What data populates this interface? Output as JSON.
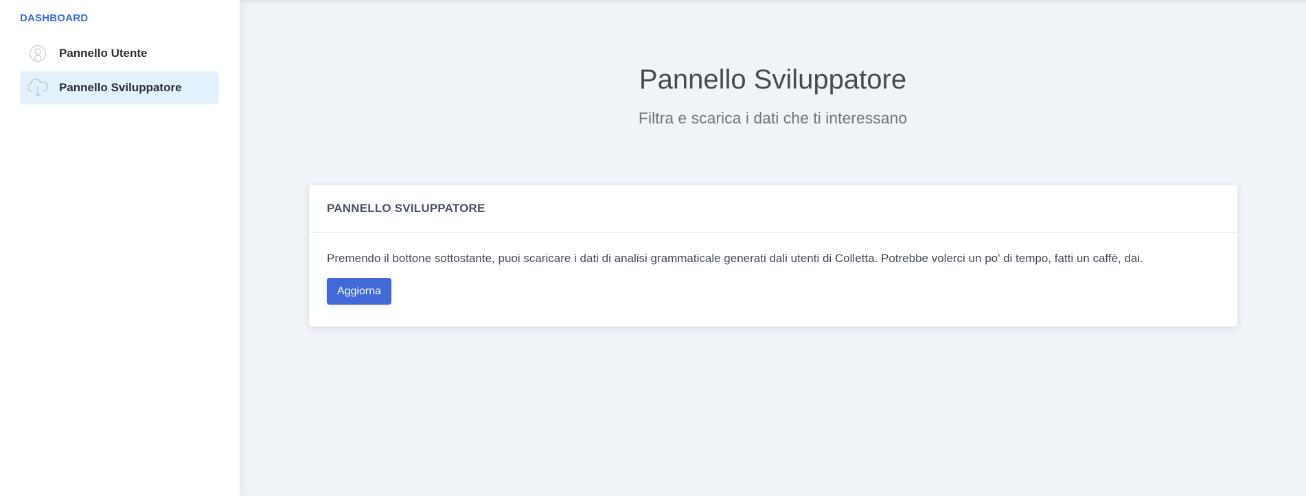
{
  "sidebar": {
    "heading": "DASHBOARD",
    "items": [
      {
        "label": "Pannello Utente",
        "icon": "user-circle-icon",
        "active": false
      },
      {
        "label": "Pannello Sviluppatore",
        "icon": "cloud-download-icon",
        "active": true
      }
    ]
  },
  "main": {
    "title": "Pannello Sviluppatore",
    "subtitle": "Filtra e scarica i dati che ti interessano",
    "card": {
      "title": "PANNELLO SVILUPPATORE",
      "text": "Premendo il bottone sottostante, puoi scaricare i dati di analisi grammaticale generati dali utenti di Colletta. Potrebbe volerci un po' di tempo, fatti un caffè, dai.",
      "button_label": "Aggiorna"
    }
  },
  "colors": {
    "accent": "#4169d8",
    "heading_blue": "#3f68d6",
    "active_item_bg": "#e2f1fc",
    "background": "#f0f3f7"
  }
}
